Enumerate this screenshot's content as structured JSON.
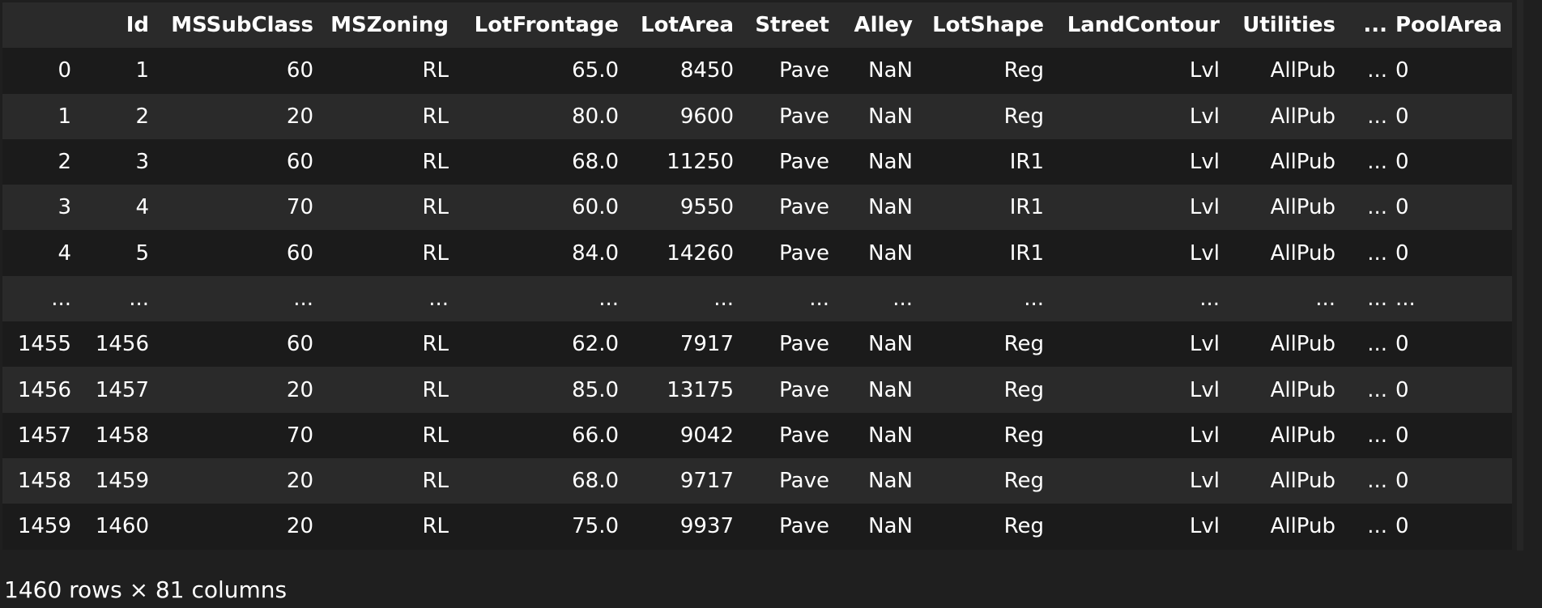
{
  "table": {
    "columns": [
      "",
      "Id",
      "MSSubClass",
      "MSZoning",
      "LotFrontage",
      "LotArea",
      "Street",
      "Alley",
      "LotShape",
      "LandContour",
      "Utilities",
      "...",
      "PoolArea"
    ],
    "rows": [
      [
        "0",
        "1",
        "60",
        "RL",
        "65.0",
        "8450",
        "Pave",
        "NaN",
        "Reg",
        "Lvl",
        "AllPub",
        "...",
        "0"
      ],
      [
        "1",
        "2",
        "20",
        "RL",
        "80.0",
        "9600",
        "Pave",
        "NaN",
        "Reg",
        "Lvl",
        "AllPub",
        "...",
        "0"
      ],
      [
        "2",
        "3",
        "60",
        "RL",
        "68.0",
        "11250",
        "Pave",
        "NaN",
        "IR1",
        "Lvl",
        "AllPub",
        "...",
        "0"
      ],
      [
        "3",
        "4",
        "70",
        "RL",
        "60.0",
        "9550",
        "Pave",
        "NaN",
        "IR1",
        "Lvl",
        "AllPub",
        "...",
        "0"
      ],
      [
        "4",
        "5",
        "60",
        "RL",
        "84.0",
        "14260",
        "Pave",
        "NaN",
        "IR1",
        "Lvl",
        "AllPub",
        "...",
        "0"
      ],
      [
        "...",
        "...",
        "...",
        "...",
        "...",
        "...",
        "...",
        "...",
        "...",
        "...",
        "...",
        "...",
        "..."
      ],
      [
        "1455",
        "1456",
        "60",
        "RL",
        "62.0",
        "7917",
        "Pave",
        "NaN",
        "Reg",
        "Lvl",
        "AllPub",
        "...",
        "0"
      ],
      [
        "1456",
        "1457",
        "20",
        "RL",
        "85.0",
        "13175",
        "Pave",
        "NaN",
        "Reg",
        "Lvl",
        "AllPub",
        "...",
        "0"
      ],
      [
        "1457",
        "1458",
        "70",
        "RL",
        "66.0",
        "9042",
        "Pave",
        "NaN",
        "Reg",
        "Lvl",
        "AllPub",
        "...",
        "0"
      ],
      [
        "1458",
        "1459",
        "20",
        "RL",
        "68.0",
        "9717",
        "Pave",
        "NaN",
        "Reg",
        "Lvl",
        "AllPub",
        "...",
        "0"
      ],
      [
        "1459",
        "1460",
        "20",
        "RL",
        "75.0",
        "9937",
        "Pave",
        "NaN",
        "Reg",
        "Lvl",
        "AllPub",
        "...",
        "0"
      ]
    ]
  },
  "footer": {
    "summary": "1460 rows × 81 columns"
  }
}
